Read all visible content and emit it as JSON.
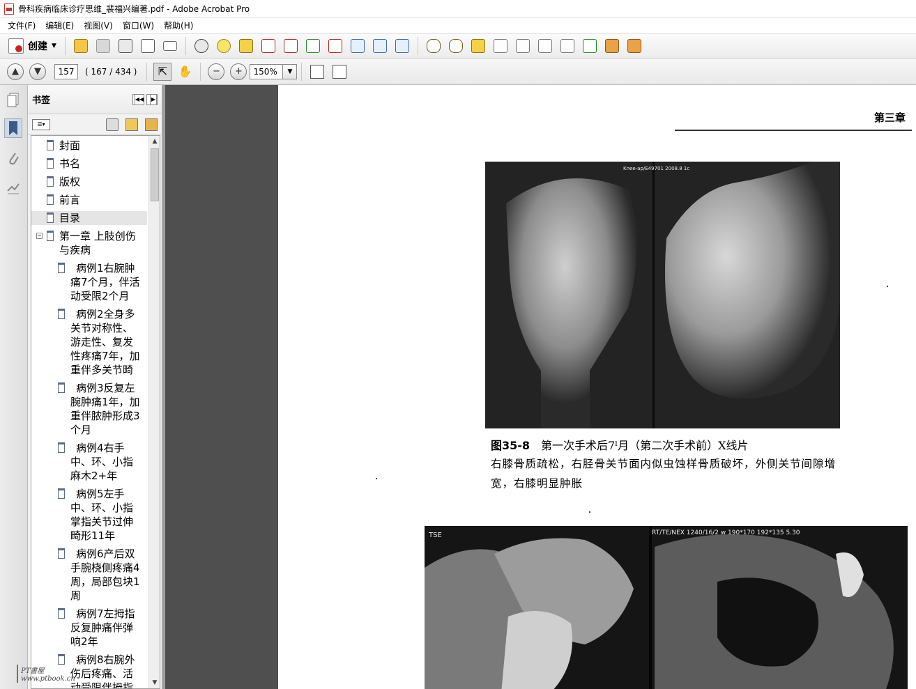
{
  "window": {
    "title": "骨科疾病临床诊疗思维_裴福兴编著.pdf - Adobe Acrobat Pro"
  },
  "menu": [
    "文件(F)",
    "编辑(E)",
    "视图(V)",
    "窗口(W)",
    "帮助(H)"
  ],
  "toolbar": {
    "create_label": "创建",
    "icons": [
      "open-icon",
      "save-icon",
      "print-icon",
      "edit-document-icon",
      "email-icon",
      "settings-icon",
      "comment-icon",
      "highlight-icon",
      "stamp-delete-icon",
      "clip-icon",
      "export-icon",
      "sign-icon",
      "form-icon",
      "copy-icon",
      "page-options-icon",
      "link-icon",
      "unlink-icon",
      "review-icon",
      "attach-icon",
      "page-icon",
      "measure-icon",
      "action-icon",
      "book-icon",
      "extract-icon"
    ]
  },
  "navigation": {
    "current_page": "157",
    "page_count": "( 167 / 434 )",
    "zoom": "150%"
  },
  "bookmarks_panel": {
    "title": "书签",
    "items": [
      {
        "label": "封面"
      },
      {
        "label": "书名"
      },
      {
        "label": "版权"
      },
      {
        "label": "前言"
      },
      {
        "label": "目录",
        "selected": true
      },
      {
        "label": "第一章  上肢创伤与疾病",
        "lines": [
          "第一章  上肢创伤",
          "与疾病"
        ],
        "expandable": true,
        "expander": "−"
      },
      {
        "label": "病例1右腕肿痛7个月，伴活动受限2个月",
        "lines": [
          "病例1右腕肿",
          "痛7个月，伴活",
          "动受限2个月"
        ]
      },
      {
        "label": "病例2全身多关节对称性、游走性、复发性疼痛7年，加重伴多关节畸",
        "lines": [
          "病例2全身多",
          "关节对称性、",
          "游走性、复发",
          "性疼痛7年，加",
          "重伴多关节畸"
        ]
      },
      {
        "label": "病例3反复左腕肿痛1年，加重伴脓肿形成3个月",
        "lines": [
          "病例3反复左",
          "腕肿痛1年，加",
          "重伴脓肿形成3",
          "个月"
        ]
      },
      {
        "label": "病例4右手中、环、小指麻木2+年",
        "lines": [
          "病例4右手",
          "中、环、小指",
          "麻木2+年"
        ]
      },
      {
        "label": "病例5左手中、环、小指掌指关节过伸畸形11年",
        "lines": [
          "病例5左手",
          "中、环、小指",
          "掌指关节过伸",
          "畸形11年"
        ]
      },
      {
        "label": "病例6产后双手腕桡侧疼痛4周，局部包块1周",
        "lines": [
          "病例6产后双",
          "手腕桡侧疼痛4",
          "周，局部包块1",
          "周"
        ]
      },
      {
        "label": "病例7左拇指反复肿痛伴弹响2年",
        "lines": [
          "病例7左拇指",
          "反复肿痛伴弹",
          "响2年"
        ]
      },
      {
        "label": "病例8右腕外伤后疼痛、活动受限伴拇指",
        "lines": [
          "病例8右腕外",
          "伤后疼痛、活",
          "动受限伴拇指"
        ]
      }
    ]
  },
  "document": {
    "running_header": "第三章",
    "figure_label": "图35-8",
    "figure_caption": "第一次手术后7ˡ月（第二次手术前）X线片",
    "figure_body": "右膝骨质疏松，右胫骨关节面内似虫蚀样骨质破坏，外侧关节间隙增宽，右膝明显肿胀",
    "xray_overlay_text": "Knee-ap/E49701 2008.8 1c",
    "mri_overlay_left": "TSE",
    "mri_overlay_right": "RT/TE/NEX 1240/16/2  w 190*170  192*135  5.30"
  },
  "colors": {
    "gutter": "#4f4f4f",
    "panel": "#f2f2f2",
    "bookmark_flag": "#5a6c86",
    "accent_red": "#cc2222"
  },
  "watermark": {
    "text": "PT書屋 www.ptbook.cn"
  }
}
